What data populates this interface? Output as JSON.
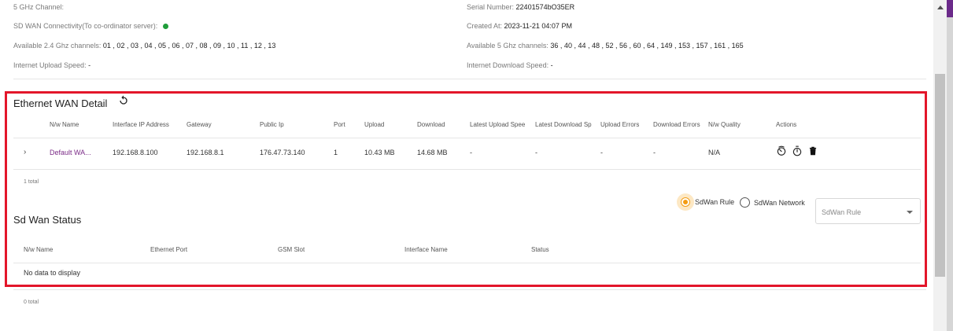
{
  "device_info": {
    "left": [
      {
        "label": "5 GHz Channel:",
        "value": ""
      },
      {
        "label": "SD WAN Connectivity(To co-ordinator server):",
        "value": ""
      },
      {
        "label": "Available 2.4 Ghz channels:",
        "value": "01 , 02 , 03 , 04 , 05 , 06 , 07 , 08 , 09 , 10 , 11 , 12 , 13"
      },
      {
        "label": "Internet Upload Speed:",
        "value": "-"
      }
    ],
    "right": [
      {
        "label": "Serial Number:",
        "value": "22401574bO35ER"
      },
      {
        "label": "Created At:",
        "value": "2023-11-21 04:07 PM"
      },
      {
        "label": "Available 5 Ghz channels:",
        "value": "36 , 40 , 44 , 48 , 52 , 56 , 60 , 64 , 149 , 153 , 157 , 161 , 165"
      },
      {
        "label": "Internet Download Speed:",
        "value": "-"
      }
    ],
    "sdwan_status_color": "#1f9d3a"
  },
  "ethernet_wan": {
    "title": "Ethernet WAN Detail",
    "columns": [
      "N/w Name",
      "Interface IP Address",
      "Gateway",
      "Public Ip",
      "Port",
      "Upload",
      "Download",
      "Latest Upload Speed",
      "Latest Download Speed",
      "Upload Errors",
      "Download Errors",
      "N/w Quality",
      "Actions"
    ],
    "rows": [
      {
        "name": "Default WA...",
        "ip": "192.168.8.100",
        "gateway": "192.168.8.1",
        "public_ip": "176.47.73.140",
        "port": "1",
        "upload": "10.43 MB",
        "download": "14.68 MB",
        "latest_upload": "-",
        "latest_download": "-",
        "upload_errors": "-",
        "download_errors": "-",
        "quality": "N/A",
        "actions": [
          "speedometer-icon",
          "stopwatch-icon",
          "trash-icon"
        ]
      }
    ],
    "total": "1 total"
  },
  "sdwan": {
    "title": "Sd Wan Status",
    "radio_options": [
      {
        "label": "SdWan Rule",
        "selected": true
      },
      {
        "label": "SdWan Network",
        "selected": false
      }
    ],
    "select_value": "SdWan Rule",
    "columns": [
      "N/w Name",
      "Ethernet Port",
      "GSM Slot",
      "Interface Name",
      "Status"
    ],
    "empty_text": "No data to display",
    "total": "0 total"
  },
  "colors": {
    "accent": "#f39c12",
    "link": "#7b2b87",
    "highlight": "#e3162a"
  }
}
